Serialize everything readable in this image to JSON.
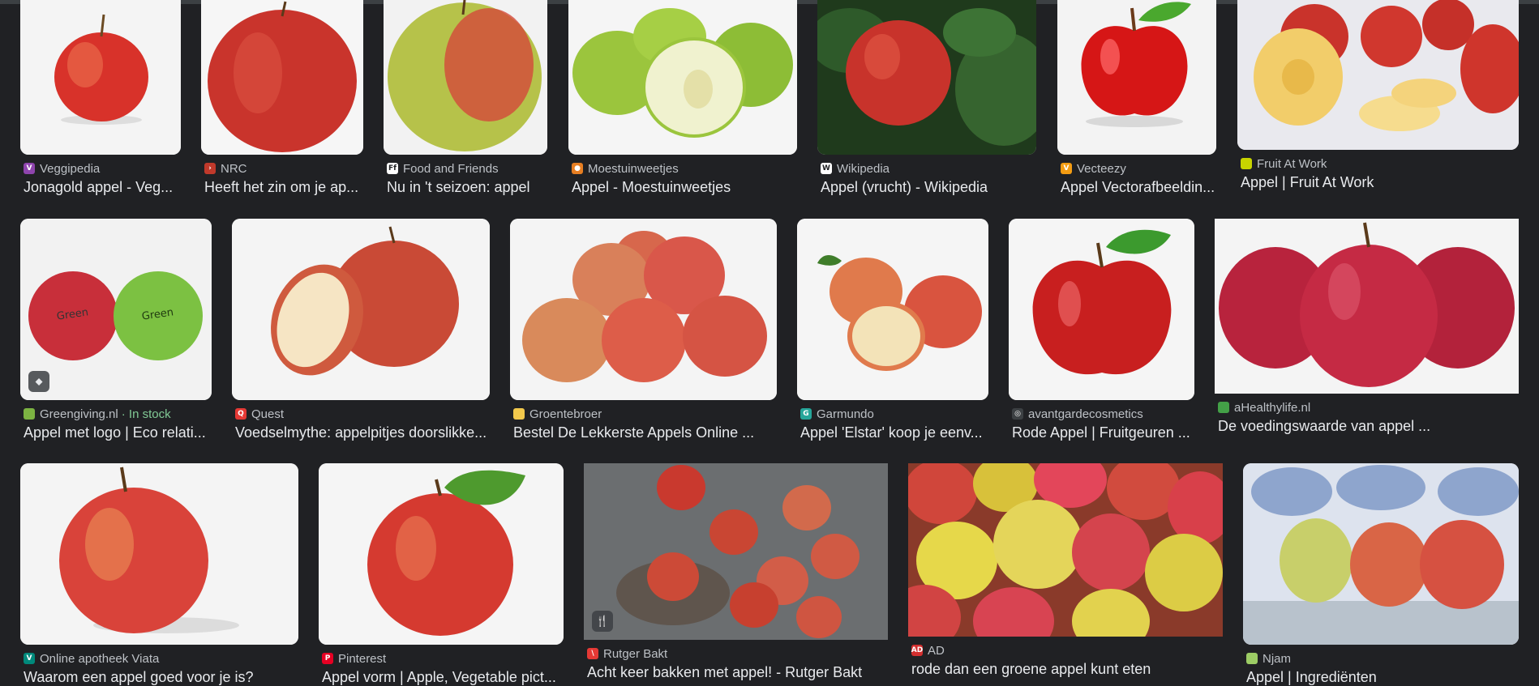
{
  "cards": [
    {
      "source": "Veggipedia",
      "title": "Jonagold appel - Veg...",
      "icon": "veggipedia-icon",
      "color": "#8e44ad"
    },
    {
      "source": "NRC",
      "title": "Heeft het zin om je ap...",
      "icon": "nrc-icon",
      "color": "#c0392b"
    },
    {
      "source": "Food and Friends",
      "title": "Nu in 't seizoen: appel",
      "icon": "food-and-friends-icon",
      "color": "#ffffff"
    },
    {
      "source": "Moestuinweetjes",
      "title": "Appel - Moestuinweetjes",
      "icon": "moestuinweetjes-icon",
      "color": "#e67e22"
    },
    {
      "source": "Wikipedia",
      "title": "Appel (vrucht) - Wikipedia",
      "icon": "wikipedia-icon",
      "color": "#ffffff"
    },
    {
      "source": "Vecteezy",
      "title": "Appel Vectorafbeeldin...",
      "icon": "vecteezy-icon",
      "color": "#f39c12"
    },
    {
      "source": "Fruit At Work",
      "title": "Appel | Fruit At Work",
      "icon": "fruit-at-work-icon",
      "color": "#c8d400"
    },
    {
      "source": "Greengiving.nl",
      "stock": "In stock",
      "title": "Appel met logo | Eco relati...",
      "icon": "greengiving-icon",
      "color": "#7cb342"
    },
    {
      "source": "Quest",
      "title": "Voedselmythe: appelpitjes doorslikke...",
      "icon": "quest-icon",
      "color": "#e53935"
    },
    {
      "source": "Groentebroer",
      "title": "Bestel De Lekkerste Appels Online ...",
      "icon": "groentebroer-icon",
      "color": "#f2c94c"
    },
    {
      "source": "Garmundo",
      "title": "Appel 'Elstar' koop je eenv...",
      "icon": "garmundo-icon",
      "color": "#26a69a"
    },
    {
      "source": "avantgardecosmetics",
      "title": "Rode Appel | Fruitgeuren ...",
      "icon": "globe-icon",
      "color": "#3c4043"
    },
    {
      "source": "aHealthylife.nl",
      "title": "De voedingswaarde van appel ...",
      "icon": "ahealthylife-icon",
      "color": "#43a047"
    },
    {
      "source": "Online apotheek Viata",
      "title": "Waarom een appel goed voor je is?",
      "icon": "viata-icon",
      "color": "#00897b"
    },
    {
      "source": "Pinterest",
      "title": "Appel vorm | Apple, Vegetable pict...",
      "icon": "pinterest-icon",
      "color": "#e60023"
    },
    {
      "source": "Rutger Bakt",
      "title": "Acht keer bakken met appel! - Rutger Bakt",
      "icon": "rutger-bakt-icon",
      "color": "#e53935"
    },
    {
      "source": "AD",
      "title": "rode dan een groene appel kunt eten",
      "icon": "ad-icon",
      "color": "#d32f2f"
    },
    {
      "source": "Njam",
      "title": "Appel | Ingrediënten",
      "icon": "njam-icon",
      "color": "#9ccc65"
    }
  ]
}
